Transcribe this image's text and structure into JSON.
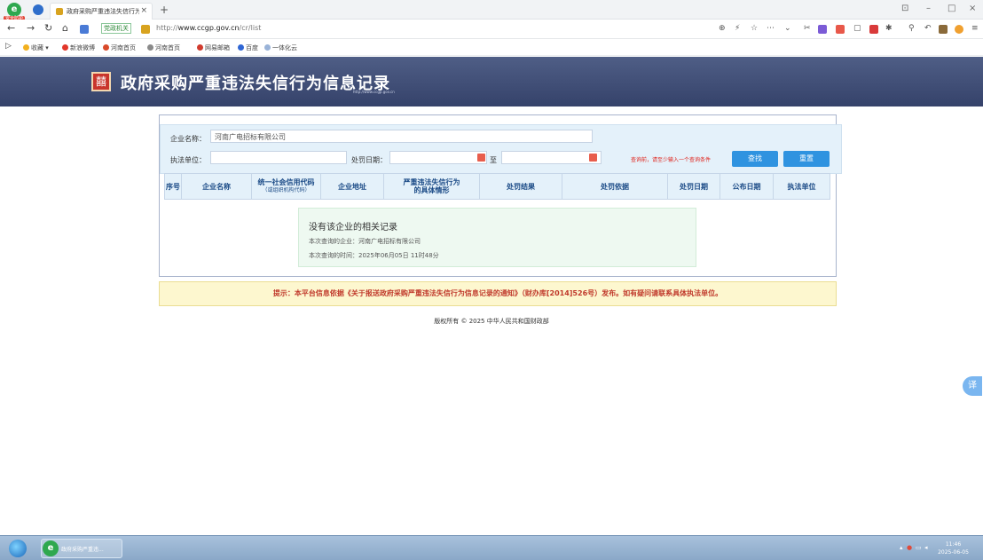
{
  "browser": {
    "tab_title": "政府采购严重违法失信行为信",
    "brand_tag": "安全防护",
    "bookmark_first": "党政机关",
    "url_prefix": "http://",
    "url_domain": "www.ccgp.gov.cn",
    "url_path": "/cr/list",
    "bookmarks": [
      "收藏",
      "新浪微博",
      "河南首页",
      "河南首页",
      "网易邮箱",
      "百度",
      "一体化云"
    ]
  },
  "site": {
    "title": "政府采购严重违法失信行为信息记录",
    "url": "http://www.ccgp.gov.cn"
  },
  "search": {
    "company_label": "企业名称：",
    "company_value": "河南广电招标有限公司",
    "agency_label": "执法单位：",
    "agency_value": "",
    "date_label": "处罚日期：",
    "date_from": "",
    "date_to_label": "至",
    "date_to": "",
    "hint": "查询前，请至少输入一个查询条件",
    "search_button": "查找",
    "reset_button": "重置"
  },
  "table": {
    "headers": [
      {
        "label": "序号",
        "sub": ""
      },
      {
        "label": "企业名称",
        "sub": ""
      },
      {
        "label": "统一社会信用代码",
        "sub": "（或组织机构代码）"
      },
      {
        "label": "企业地址",
        "sub": ""
      },
      {
        "label": "严重违法失信行为的具体情形",
        "sub": ""
      },
      {
        "label": "处罚结果",
        "sub": ""
      },
      {
        "label": "处罚依据",
        "sub": ""
      },
      {
        "label": "处罚日期",
        "sub": ""
      },
      {
        "label": "公布日期",
        "sub": ""
      },
      {
        "label": "执法单位",
        "sub": ""
      }
    ]
  },
  "no_result": {
    "title": "没有该企业的相关记录",
    "company_line": "本次查询的企业：河南广电招标有限公司",
    "time_line": "本次查询的时间：2025年06月05日 11时48分"
  },
  "notice": "提示：本平台信息依据《关于报送政府采购严重违法失信行为信息记录的通知》（财办库[2014]526号）发布。如有疑问请联系具体执法单位。",
  "footer": "版权所有 © 2025 中华人民共和国财政部",
  "translate_label": "译",
  "taskbar": {
    "task_label": "政府采购严重违...",
    "time": "11:46",
    "date": "2025-06-05"
  }
}
